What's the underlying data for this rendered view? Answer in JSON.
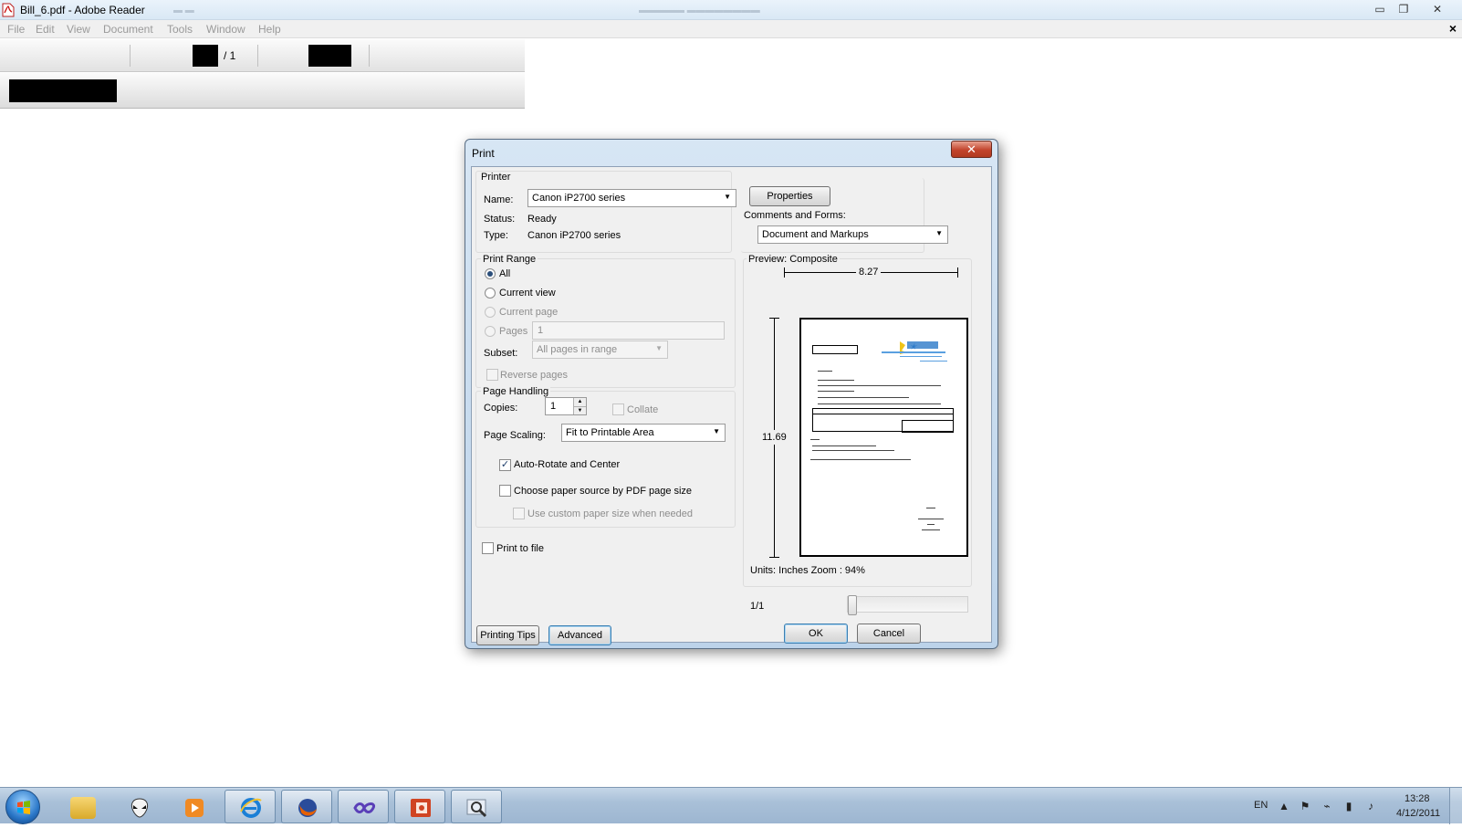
{
  "window": {
    "title": "Bill_6.pdf - Adobe Reader",
    "menu": [
      "File",
      "Edit",
      "View",
      "Document",
      "Tools",
      "Window",
      "Help"
    ],
    "doc_close_glyph": "×",
    "minimize_glyph": "▭",
    "restore_glyph": "❐",
    "close_glyph": "✕"
  },
  "toolbar": {
    "page_total": "/ 1"
  },
  "dialog": {
    "title": "Print",
    "close_glyph": "✕",
    "printer": {
      "legend": "Printer",
      "name_label": "Name:",
      "name_value": "Canon iP2700 series",
      "status_label": "Status:",
      "status_value": "Ready",
      "type_label": "Type:",
      "type_value": "Canon iP2700 series",
      "properties_button": "Properties",
      "comments_label": "Comments and Forms:",
      "comments_value": "Document and Markups"
    },
    "print_range": {
      "legend": "Print Range",
      "options": [
        {
          "label": "All",
          "selected": true,
          "enabled": true
        },
        {
          "label": "Current view",
          "selected": false,
          "enabled": true
        },
        {
          "label": "Current page",
          "selected": false,
          "enabled": false
        },
        {
          "label": "Pages",
          "selected": false,
          "enabled": false
        }
      ],
      "pages_value": "1",
      "subset_label": "Subset:",
      "subset_value": "All pages in range",
      "reverse_pages": "Reverse pages"
    },
    "page_handling": {
      "legend": "Page Handling",
      "copies_label": "Copies:",
      "copies_value": "1",
      "collate": "Collate",
      "scaling_label": "Page Scaling:",
      "scaling_value": "Fit to Printable Area",
      "auto_rotate": "Auto-Rotate and Center",
      "auto_rotate_checked": true,
      "paper_source": "Choose paper source by PDF page size",
      "custom_paper": "Use custom paper size when needed"
    },
    "print_to_file": "Print to file",
    "preview": {
      "legend": "Preview: Composite",
      "width": "8.27",
      "height": "11.69",
      "units": "Units: Inches Zoom :  94%",
      "page": "1/1"
    },
    "buttons": {
      "printing_tips": "Printing Tips",
      "advanced": "Advanced",
      "ok": "OK",
      "cancel": "Cancel"
    }
  },
  "taskbar": {
    "language": "EN",
    "time": "13:28",
    "date": "4/12/2011",
    "apps": [
      "start-orb",
      "file-explorer",
      "alien-app",
      "media-player",
      "internet-explorer",
      "firefox",
      "visual-studio",
      "powerpoint",
      "image-viewer"
    ]
  },
  "colors": {
    "title_gradient": "#d9e8f5",
    "dialog_frame": "#bcd3ea",
    "close_red": "#c2442c",
    "taskbar": "#a9c0d8"
  }
}
